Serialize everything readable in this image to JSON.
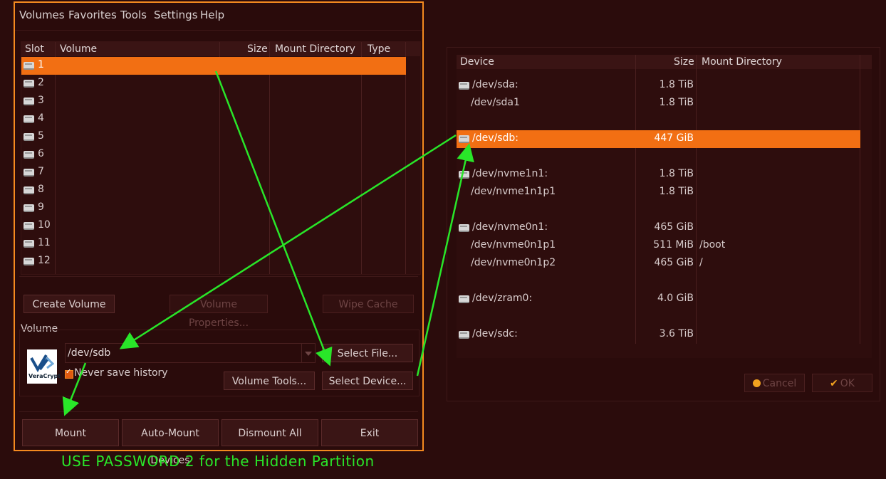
{
  "main_window": {
    "menu": [
      "Volumes",
      "Favorites",
      "Tools",
      "Settings",
      "Help"
    ],
    "columns": [
      "Slot",
      "Volume",
      "Size",
      "Mount Directory",
      "Type"
    ],
    "slots": [
      "1",
      "2",
      "3",
      "4",
      "5",
      "6",
      "7",
      "8",
      "9",
      "10",
      "11",
      "12"
    ],
    "selected_slot": "1",
    "buttons": {
      "create_volume": "Create Volume",
      "volume_properties": "Volume Properties...",
      "wipe_cache": "Wipe Cache",
      "select_file": "Select File...",
      "volume_tools": "Volume Tools...",
      "select_device": "Select Device...",
      "mount": "Mount",
      "auto_mount": "Auto-Mount Devices",
      "dismount_all": "Dismount All",
      "exit": "Exit"
    },
    "volume_group_label": "Volume",
    "volume_path": "/dev/sdb",
    "never_save_history": "Never save history",
    "never_save_history_checked": true,
    "logo_text": "VeraCrypt"
  },
  "device_dialog": {
    "columns": [
      "Device",
      "Size",
      "Mount Directory"
    ],
    "rows": [
      {
        "device": "/dev/sda:",
        "size": "1.8 TiB",
        "mount": "",
        "disk": true
      },
      {
        "device": "/dev/sda1",
        "size": "1.8 TiB",
        "mount": "",
        "disk": false
      },
      {
        "device": "",
        "size": "",
        "mount": "",
        "disk": false,
        "blank": true
      },
      {
        "device": "/dev/sdb:",
        "size": "447 GiB",
        "mount": "",
        "disk": true,
        "selected": true
      },
      {
        "device": "",
        "size": "",
        "mount": "",
        "disk": false,
        "blank": true
      },
      {
        "device": "/dev/nvme1n1:",
        "size": "1.8 TiB",
        "mount": "",
        "disk": true
      },
      {
        "device": "/dev/nvme1n1p1",
        "size": "1.8 TiB",
        "mount": "",
        "disk": false
      },
      {
        "device": "",
        "size": "",
        "mount": "",
        "disk": false,
        "blank": true
      },
      {
        "device": "/dev/nvme0n1:",
        "size": "465 GiB",
        "mount": "",
        "disk": true
      },
      {
        "device": "/dev/nvme0n1p1",
        "size": "511 MiB",
        "mount": "/boot",
        "disk": false
      },
      {
        "device": "/dev/nvme0n1p2",
        "size": "465 GiB",
        "mount": "/",
        "disk": false
      },
      {
        "device": "",
        "size": "",
        "mount": "",
        "disk": false,
        "blank": true
      },
      {
        "device": "/dev/zram0:",
        "size": "4.0 GiB",
        "mount": "",
        "disk": true
      },
      {
        "device": "",
        "size": "",
        "mount": "",
        "disk": false,
        "blank": true
      },
      {
        "device": "/dev/sdc:",
        "size": "3.6 TiB",
        "mount": "",
        "disk": true
      }
    ],
    "cancel": "Cancel",
    "ok": "OK"
  },
  "annotation": "USE PASSWORD 2 for the Hidden Partition",
  "colors": {
    "accent": "#f26f13",
    "border": "#f58a1f",
    "arrow": "#29e629",
    "background": "#2b0c0c"
  }
}
